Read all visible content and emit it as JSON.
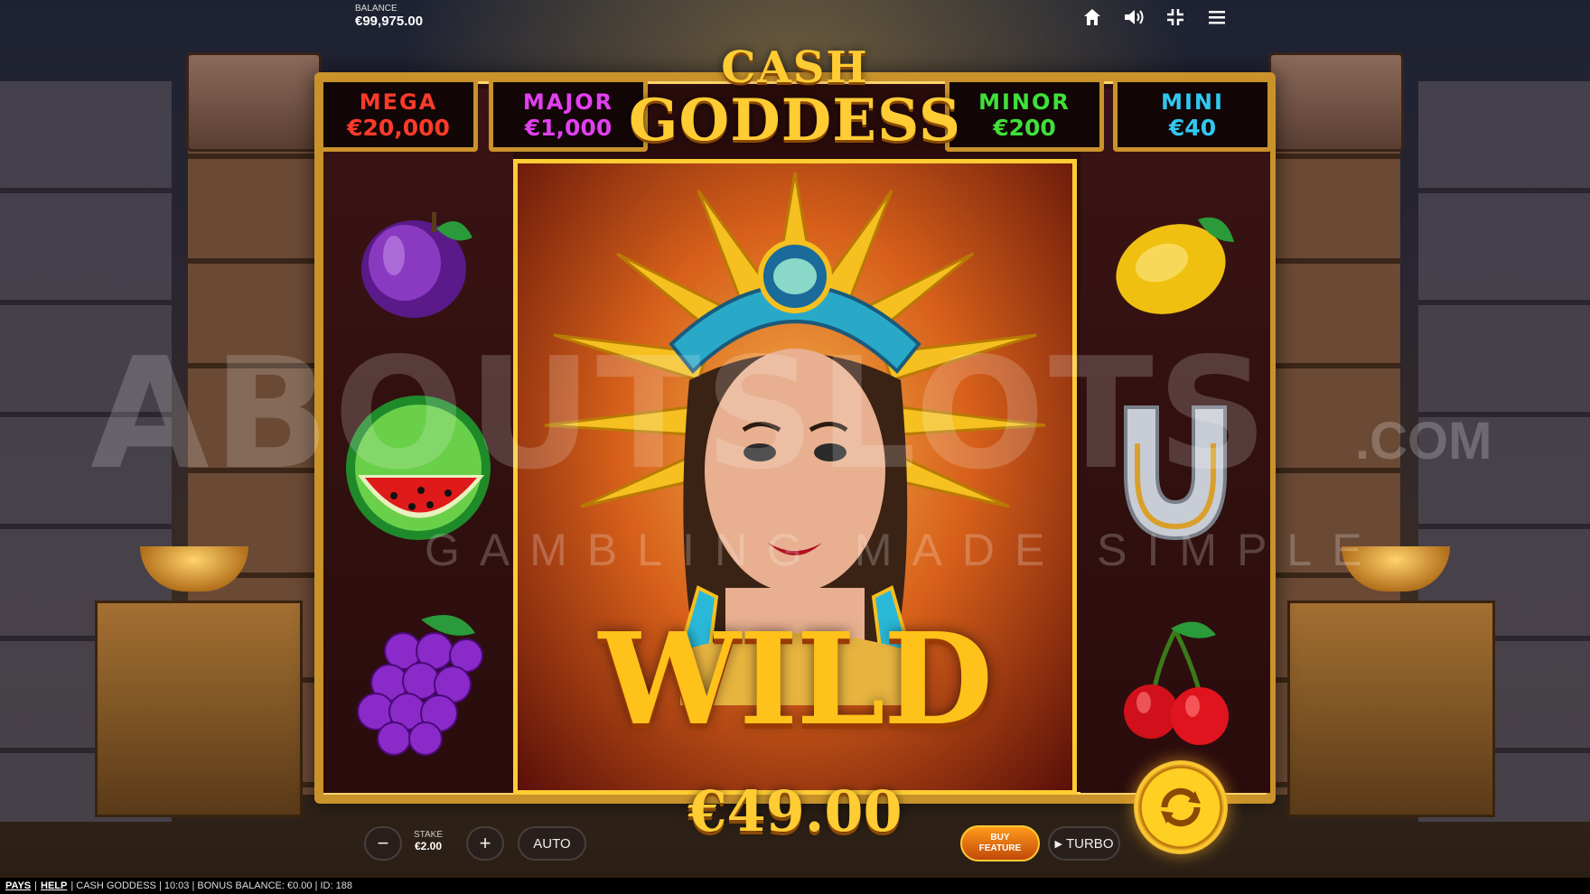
{
  "balance": {
    "label": "BALANCE",
    "value": "€99,975.00"
  },
  "top_icons": [
    "home-icon",
    "sound-icon",
    "fullscreen-exit-icon",
    "menu-icon"
  ],
  "jackpots": [
    {
      "label": "MEGA",
      "amount": "€20,000",
      "color": "#ff3a2a"
    },
    {
      "label": "MAJOR",
      "amount": "€1,000",
      "color": "#e23ff0"
    },
    {
      "label": "MINOR",
      "amount": "€200",
      "color": "#3fe03a"
    },
    {
      "label": "MINI",
      "amount": "€40",
      "color": "#30c8f0"
    }
  ],
  "logo": {
    "line1": "CASH",
    "line2": "GODDESS"
  },
  "reels": {
    "left": [
      "plum",
      "watermelon",
      "grapes"
    ],
    "right": [
      "lemon",
      "horseshoe",
      "cherries"
    ],
    "center": "wild"
  },
  "wild_label": "WILD",
  "win_amount": "€49.00",
  "watermark": {
    "main": "ABOUTSLOTS",
    "com": ".COM",
    "tagline": "GAMBLING MADE SIMPLE"
  },
  "controls": {
    "minus": "−",
    "plus": "+",
    "stake_label": "STAKE",
    "stake_value": "€2.00",
    "auto": "AUTO",
    "buy_line1": "BUY",
    "buy_line2": "FEATURE",
    "turbo": "TURBO"
  },
  "footer": {
    "pays": "PAYS",
    "help": "HELP",
    "info": "| CASH GODDESS | 10:03 | BONUS BALANCE: €0.00 | ID: 188"
  },
  "colors": {
    "gold": "#ffcc33",
    "frame": "#c9922a",
    "spin": "#ffd024"
  }
}
